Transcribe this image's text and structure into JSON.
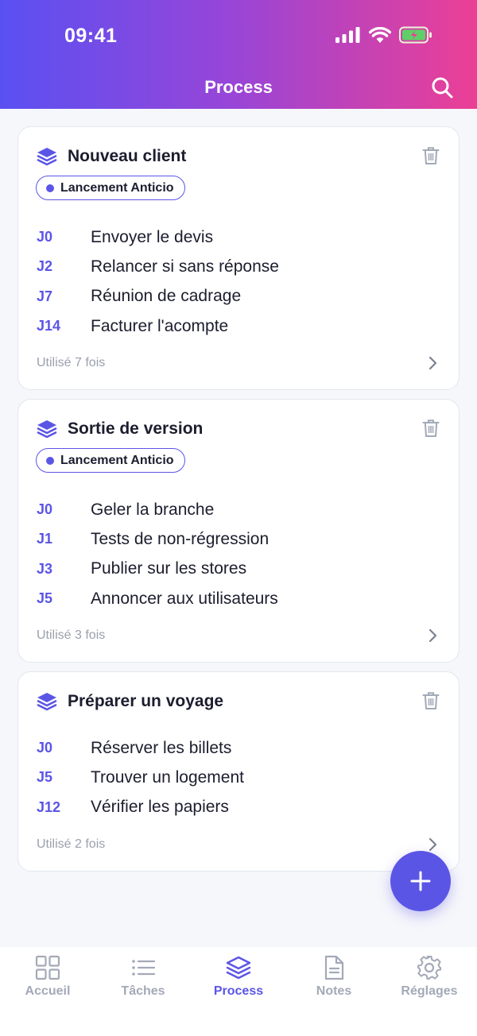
{
  "status_bar": {
    "time": "09:41"
  },
  "header": {
    "title": "Process"
  },
  "processes": [
    {
      "title": "Nouveau client",
      "tag": "Lancement Anticio",
      "steps": [
        {
          "day": "J0",
          "label": "Envoyer le devis"
        },
        {
          "day": "J2",
          "label": "Relancer si sans réponse"
        },
        {
          "day": "J7",
          "label": "Réunion de cadrage"
        },
        {
          "day": "J14",
          "label": "Facturer l'acompte"
        }
      ],
      "usage": "Utilisé 7 fois"
    },
    {
      "title": "Sortie de version",
      "tag": "Lancement Anticio",
      "steps": [
        {
          "day": "J0",
          "label": "Geler la branche"
        },
        {
          "day": "J1",
          "label": "Tests de non-régression"
        },
        {
          "day": "J3",
          "label": "Publier sur les stores"
        },
        {
          "day": "J5",
          "label": "Annoncer aux utilisateurs"
        }
      ],
      "usage": "Utilisé 3 fois"
    },
    {
      "title": "Préparer un voyage",
      "tag": "",
      "steps": [
        {
          "day": "J0",
          "label": "Réserver les billets"
        },
        {
          "day": "J5",
          "label": "Trouver un logement"
        },
        {
          "day": "J12",
          "label": "Vérifier les papiers"
        }
      ],
      "usage": "Utilisé 2 fois"
    }
  ],
  "tabbar": {
    "items": [
      {
        "label": "Accueil",
        "icon": "grid-icon",
        "active": false
      },
      {
        "label": "Tâches",
        "icon": "list-icon",
        "active": false
      },
      {
        "label": "Process",
        "icon": "layers-icon",
        "active": true
      },
      {
        "label": "Notes",
        "icon": "document-icon",
        "active": false
      },
      {
        "label": "Réglages",
        "icon": "gear-icon",
        "active": false
      }
    ]
  },
  "colors": {
    "accent": "#5b55e6",
    "header_gradient_start": "#5a50f2",
    "header_gradient_end": "#ec3f95",
    "tab_inactive": "#a3a9b7",
    "muted_text": "#9aa0ad",
    "battery_fill": "#5fd068"
  }
}
